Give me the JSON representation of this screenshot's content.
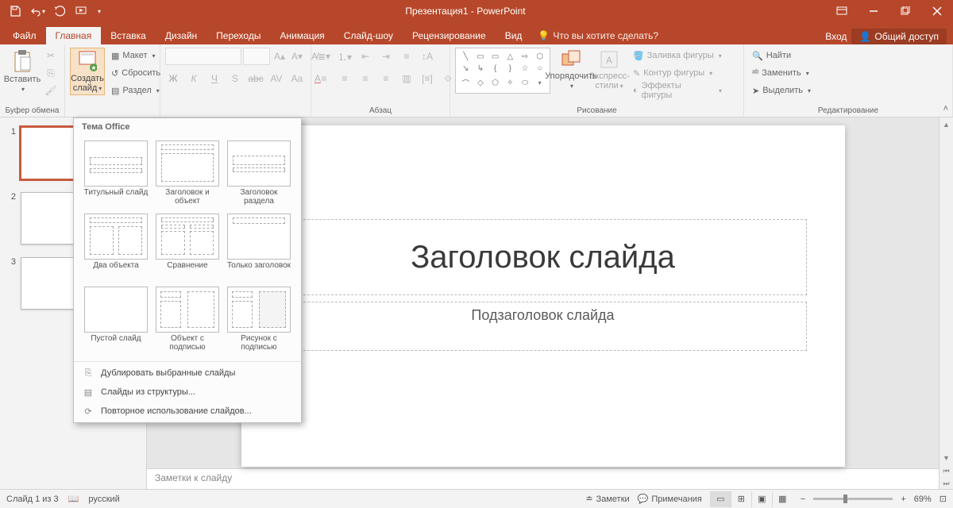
{
  "app": {
    "title": "Презентация1 - PowerPoint"
  },
  "window": {
    "login_label": "Вход",
    "share_label": "Общий доступ"
  },
  "tabs": {
    "file": "Файл",
    "items": [
      "Главная",
      "Вставка",
      "Дизайн",
      "Переходы",
      "Анимация",
      "Слайд-шоу",
      "Рецензирование",
      "Вид"
    ],
    "active_index": 0,
    "tell_me": "Что вы хотите сделать?"
  },
  "ribbon": {
    "clipboard": {
      "paste": "Вставить",
      "label": "Буфер обмена"
    },
    "slides": {
      "new_slide": "Создать\nслайд",
      "layout": "Макет",
      "reset": "Сбросить",
      "section": "Раздел",
      "label": ""
    },
    "font": {
      "label": ""
    },
    "paragraph": {
      "label": "Абзац"
    },
    "drawing": {
      "arrange": "Упорядочить",
      "quick_styles": "Экспресс-\nстили",
      "shape_fill": "Заливка фигуры",
      "shape_outline": "Контур фигуры",
      "shape_effects": "Эффекты фигуры",
      "label": "Рисование"
    },
    "editing": {
      "find": "Найти",
      "replace": "Заменить",
      "select": "Выделить",
      "label": "Редактирование"
    }
  },
  "gallery": {
    "header": "Тема Office",
    "layouts": [
      "Титульный слайд",
      "Заголовок и объект",
      "Заголовок раздела",
      "Два объекта",
      "Сравнение",
      "Только заголовок",
      "Пустой слайд",
      "Объект с подписью",
      "Рисунок с подписью"
    ],
    "menu": {
      "duplicate": "Дублировать выбранные слайды",
      "from_outline": "Слайды из структуры...",
      "reuse": "Повторное использование слайдов..."
    }
  },
  "thumbnails": {
    "count": 3,
    "selected": 1
  },
  "canvas": {
    "title": "Заголовок слайда",
    "subtitle": "Подзаголовок слайда"
  },
  "notes": {
    "placeholder": "Заметки к слайду"
  },
  "status": {
    "slide_info": "Слайд 1 из 3",
    "language": "русский",
    "notes_btn": "Заметки",
    "comments_btn": "Примечания",
    "zoom": "69%"
  }
}
